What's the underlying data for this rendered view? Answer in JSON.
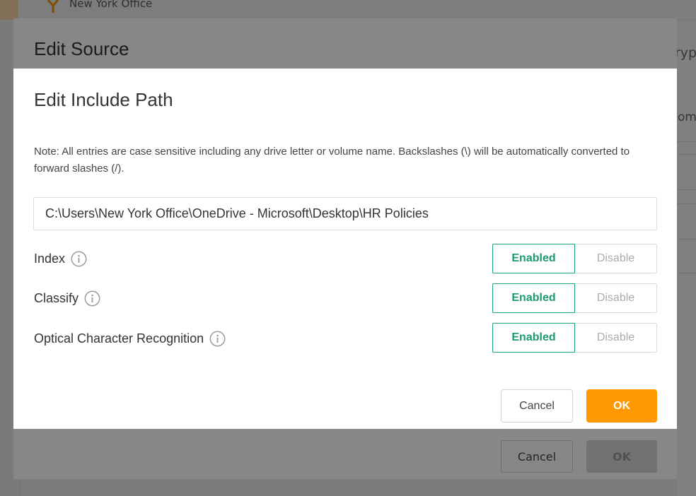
{
  "background": {
    "office_name": "New York Office",
    "right_fragment_1": "ryp",
    "right_fragment_2": "om"
  },
  "source_modal": {
    "title": "Edit Source",
    "cancel_label": "Cancel",
    "ok_label": "OK"
  },
  "dialog": {
    "title": "Edit Include Path",
    "note": "Note: All entries are case sensitive including any drive letter or volume name. Backslashes (\\) will be automatically converted to forward slashes (/).",
    "path_value": "C:\\Users\\New York Office\\OneDrive - Microsoft\\Desktop\\HR Policies",
    "settings": [
      {
        "label": "Index",
        "enabled_label": "Enabled",
        "disable_label": "Disable",
        "state": "enabled"
      },
      {
        "label": "Classify",
        "enabled_label": "Enabled",
        "disable_label": "Disable",
        "state": "enabled"
      },
      {
        "label": "Optical Character Recognition",
        "enabled_label": "Enabled",
        "disable_label": "Disable",
        "state": "enabled"
      }
    ],
    "cancel_label": "Cancel",
    "ok_label": "OK"
  },
  "colors": {
    "accent_orange": "#ff9800",
    "enabled_green": "#1d9a73",
    "overlay": "rgba(0,0,0,0.47)"
  },
  "icons": {
    "office": "network-branch-icon",
    "info": "info-circle-icon"
  }
}
